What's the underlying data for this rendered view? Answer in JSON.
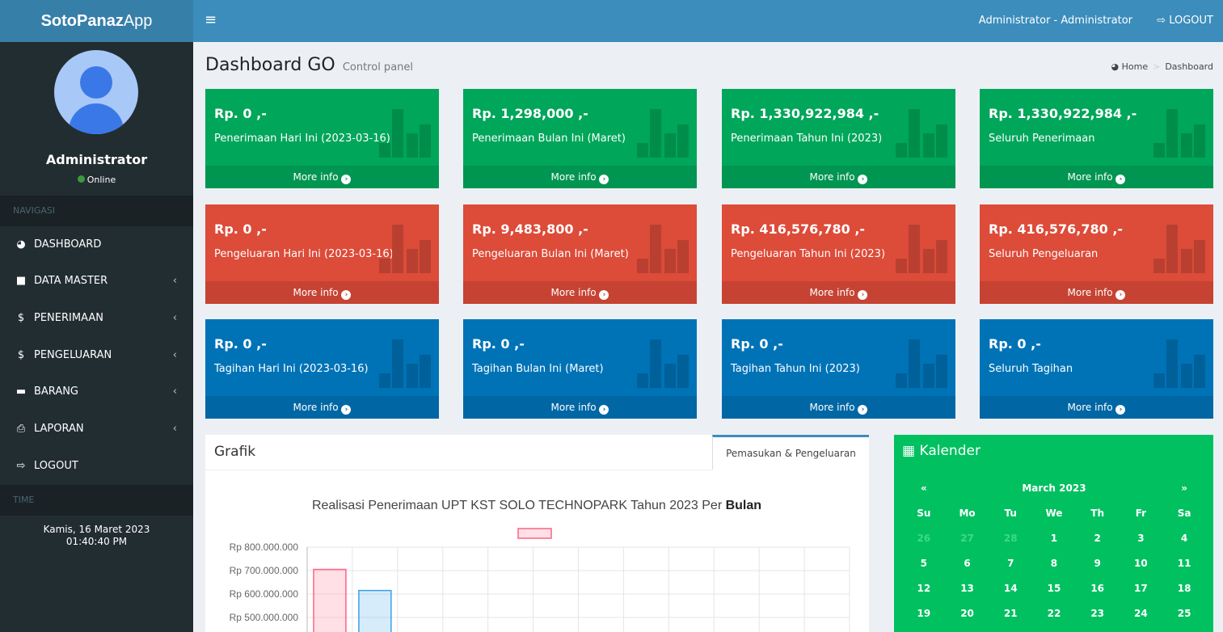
{
  "header": {
    "brand_bold": "SotoPanaz",
    "brand_light": "App",
    "user": "Administrator - Administrator",
    "logout": "LOGOUT"
  },
  "sidebar": {
    "user_name": "Administrator",
    "status": "Online",
    "nav_header": "NAVIGASI",
    "items": [
      {
        "label": "DASHBOARD",
        "icon": "dashboard-icon"
      },
      {
        "label": "DATA MASTER",
        "icon": "folder-icon"
      },
      {
        "label": "PENERIMAAN",
        "icon": "dollar-icon"
      },
      {
        "label": "PENGELUARAN",
        "icon": "dollar-icon"
      },
      {
        "label": "BARANG",
        "icon": "briefcase-icon"
      },
      {
        "label": "LAPORAN",
        "icon": "print-icon"
      },
      {
        "label": "LOGOUT",
        "icon": "logout-icon"
      }
    ],
    "time_header": "TIME",
    "date": "Kamis, 16 Maret 2023",
    "time": "01:40:40 PM"
  },
  "page": {
    "title": "Dashboard GO",
    "subtitle": "Control panel",
    "breadcrumb_home": "Home",
    "breadcrumb_current": "Dashboard"
  },
  "cards": [
    {
      "value": "Rp. 0 ,-",
      "label": "Penerimaan Hari Ini (2023-03-16)",
      "more": "More info"
    },
    {
      "value": "Rp. 1,298,000 ,-",
      "label": "Penerimaan Bulan Ini (Maret)",
      "more": "More info"
    },
    {
      "value": "Rp. 1,330,922,984 ,-",
      "label": "Penerimaan Tahun Ini (2023)",
      "more": "More info"
    },
    {
      "value": "Rp. 1,330,922,984 ,-",
      "label": "Seluruh Penerimaan",
      "more": "More info"
    },
    {
      "value": "Rp. 0 ,-",
      "label": "Pengeluaran Hari Ini (2023-03-16)",
      "more": "More info"
    },
    {
      "value": "Rp. 9,483,800 ,-",
      "label": "Pengeluaran Bulan Ini (Maret)",
      "more": "More info"
    },
    {
      "value": "Rp. 416,576,780 ,-",
      "label": "Pengeluaran Tahun Ini (2023)",
      "more": "More info"
    },
    {
      "value": "Rp. 416,576,780 ,-",
      "label": "Seluruh Pengeluaran",
      "more": "More info"
    },
    {
      "value": "Rp. 0 ,-",
      "label": "Tagihan Hari Ini (2023-03-16)",
      "more": "More info"
    },
    {
      "value": "Rp. 0 ,-",
      "label": "Tagihan Bulan Ini (Maret)",
      "more": "More info"
    },
    {
      "value": "Rp. 0 ,-",
      "label": "Tagihan Tahun Ini (2023)",
      "more": "More info"
    },
    {
      "value": "Rp. 0 ,-",
      "label": "Seluruh Tagihan",
      "more": "More info"
    }
  ],
  "grafik": {
    "title": "Grafik",
    "tab": "Pemasukan & Pengeluaran"
  },
  "chart_data": {
    "type": "bar",
    "title_prefix": "Realisasi Penerimaan UPT KST SOLO TECHNOPARK Tahun 2023 Per ",
    "title_bold": "Bulan",
    "y_ticks": [
      "Rp 800.000.000",
      "Rp 700.000.000",
      "Rp 600.000.000",
      "Rp 500.000.000"
    ],
    "ylim": [
      0,
      800000000
    ],
    "series": [
      {
        "values": [
          705000000
        ],
        "color": "#ff6384"
      },
      {
        "values": [
          615000000
        ],
        "color": "#36a2eb"
      }
    ],
    "category_count": 12
  },
  "kalender": {
    "title": "Kalender",
    "month": "March 2023",
    "prev": "«",
    "next": "»",
    "days": [
      "Su",
      "Mo",
      "Tu",
      "We",
      "Th",
      "Fr",
      "Sa"
    ],
    "weeks": [
      [
        "26",
        "27",
        "28",
        "1",
        "2",
        "3",
        "4"
      ],
      [
        "5",
        "6",
        "7",
        "8",
        "9",
        "10",
        "11"
      ],
      [
        "12",
        "13",
        "14",
        "15",
        "16",
        "17",
        "18"
      ],
      [
        "19",
        "20",
        "21",
        "22",
        "23",
        "24",
        "25"
      ]
    ]
  }
}
